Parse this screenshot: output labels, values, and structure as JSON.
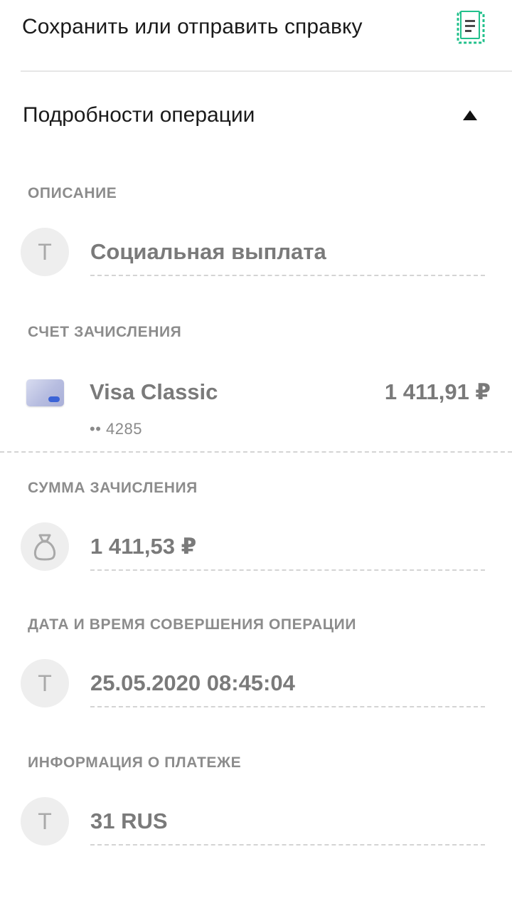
{
  "save": {
    "label": "Сохранить или отправить справку",
    "icon": "document-icon",
    "accent": "#21c08b"
  },
  "details": {
    "title": "Подробности операции",
    "toggle_icon": "chevron-up-icon"
  },
  "description": {
    "caption": "ОПИСАНИЕ",
    "avatar_letter": "Т",
    "value": "Социальная выплата"
  },
  "account": {
    "caption": "СЧЕТ ЗАЧИСЛЕНИЯ",
    "card_name": "Visa Classic",
    "card_number": "•• 4285",
    "balance": "1 411,91 ₽",
    "card_icon": "card-icon"
  },
  "amount": {
    "caption": "СУММА ЗАЧИСЛЕНИЯ",
    "icon": "money-bag-icon",
    "value": "1 411,53 ₽"
  },
  "datetime": {
    "caption": "ДАТА И ВРЕМЯ СОВЕРШЕНИЯ ОПЕРАЦИИ",
    "avatar_letter": "Т",
    "value": "25.05.2020 08:45:04"
  },
  "payment_info": {
    "caption": "ИНФОРМАЦИЯ О ПЛАТЕЖЕ",
    "avatar_letter": "Т",
    "value": "31 RUS"
  }
}
